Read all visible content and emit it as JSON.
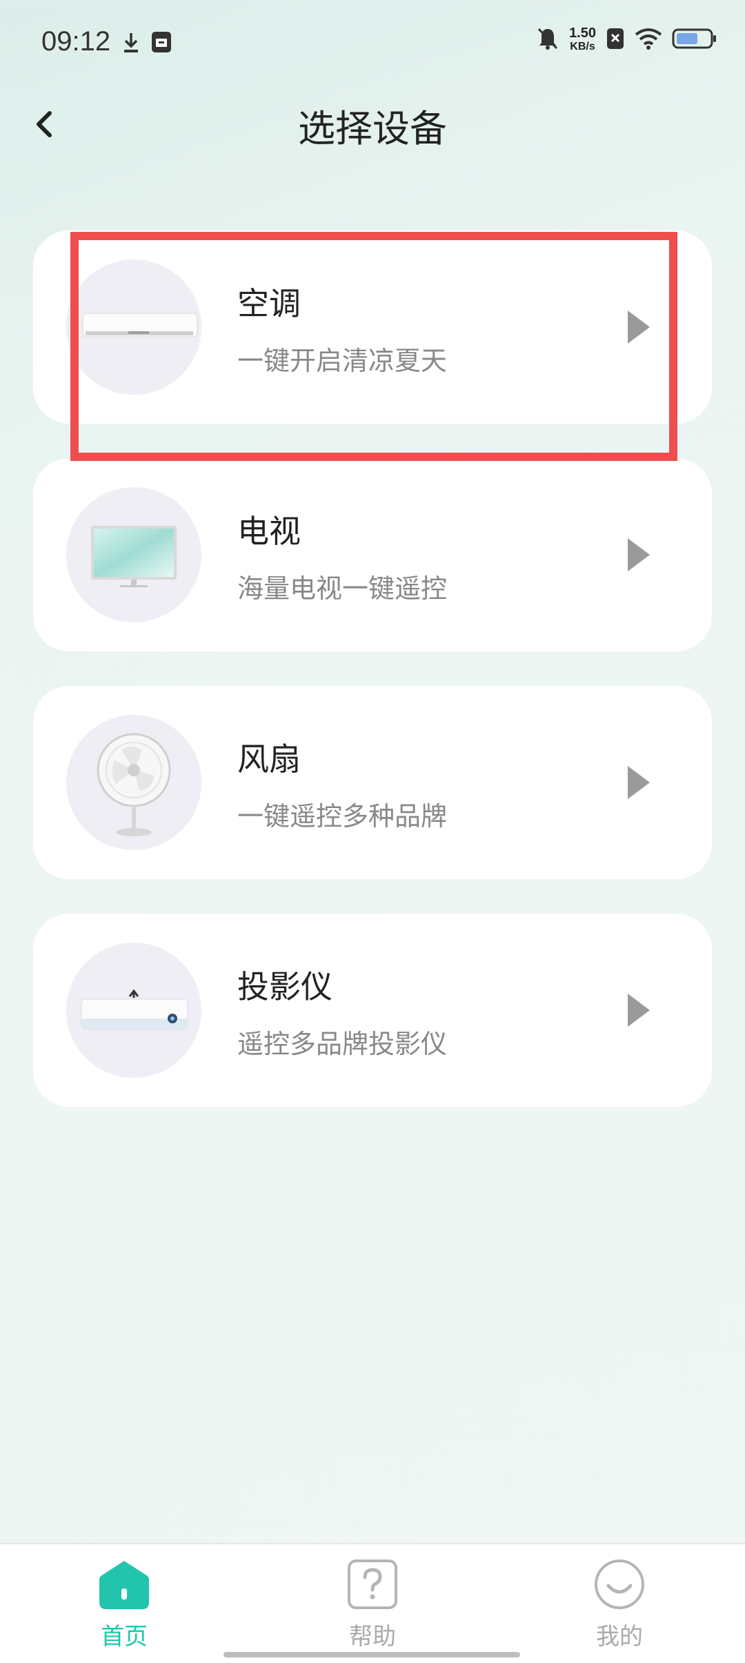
{
  "status_bar": {
    "time": "09:12",
    "net_speed_value": "1.50",
    "net_speed_unit": "KB/s",
    "icons": [
      "download-icon",
      "storage-icon",
      "mute-bell-icon",
      "sim-x-icon",
      "wifi-icon",
      "battery-icon"
    ]
  },
  "header": {
    "title": "选择设备",
    "back_icon": "chevron-left-icon"
  },
  "devices": [
    {
      "title": "空调",
      "subtitle": "一键开启清凉夏天",
      "icon": "air-conditioner-image"
    },
    {
      "title": "电视",
      "subtitle": "海量电视一键遥控",
      "icon": "tv-image"
    },
    {
      "title": "风扇",
      "subtitle": "一键遥控多种品牌",
      "icon": "fan-image"
    },
    {
      "title": "投影仪",
      "subtitle": "遥控多品牌投影仪",
      "icon": "projector-image"
    }
  ],
  "bottom_nav": [
    {
      "label": "首页",
      "icon": "home-icon",
      "active": true
    },
    {
      "label": "帮助",
      "icon": "help-icon",
      "active": false
    },
    {
      "label": "我的",
      "icon": "profile-icon",
      "active": false
    }
  ],
  "colors": {
    "accent": "#23c4ae",
    "highlight": "#ee4e4e",
    "background": "#eef6f3"
  }
}
